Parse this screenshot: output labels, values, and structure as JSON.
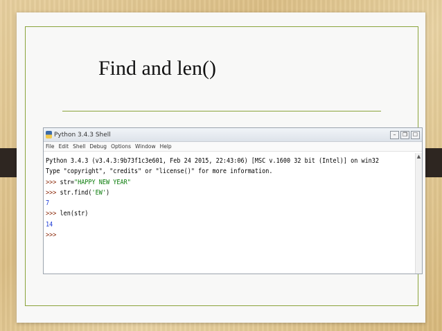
{
  "slide": {
    "title": "Find and len()"
  },
  "window": {
    "title": "Python 3.4.3 Shell",
    "controls": {
      "minimize": "–",
      "maximize": "❐",
      "close": "☐"
    }
  },
  "menu": {
    "items": [
      "File",
      "Edit",
      "Shell",
      "Debug",
      "Options",
      "Window",
      "Help"
    ]
  },
  "console": {
    "banner_line1": "Python 3.4.3 (v3.4.3:9b73f1c3e601, Feb 24 2015, 22:43:06) [MSC v.1600 32 bit (Intel)] on win32",
    "banner_line2": "Type \"copyright\", \"credits\" or \"license()\" for more information.",
    "prompt": ">>> ",
    "cmd1_code": "str=",
    "cmd1_string": "\"HAPPY NEW YEAR\"",
    "cmd2_code_a": "str.find(",
    "cmd2_string": "'EW'",
    "cmd2_code_b": ")",
    "out2": "7",
    "cmd3_code": "len(str)",
    "out3": "14"
  },
  "scrollbar": {
    "up_arrow": "▲"
  },
  "colors": {
    "prompt": "#8b2a0b",
    "string": "#0a7c0a",
    "output": "#1d3bd6",
    "frame": "#8aa33a"
  }
}
